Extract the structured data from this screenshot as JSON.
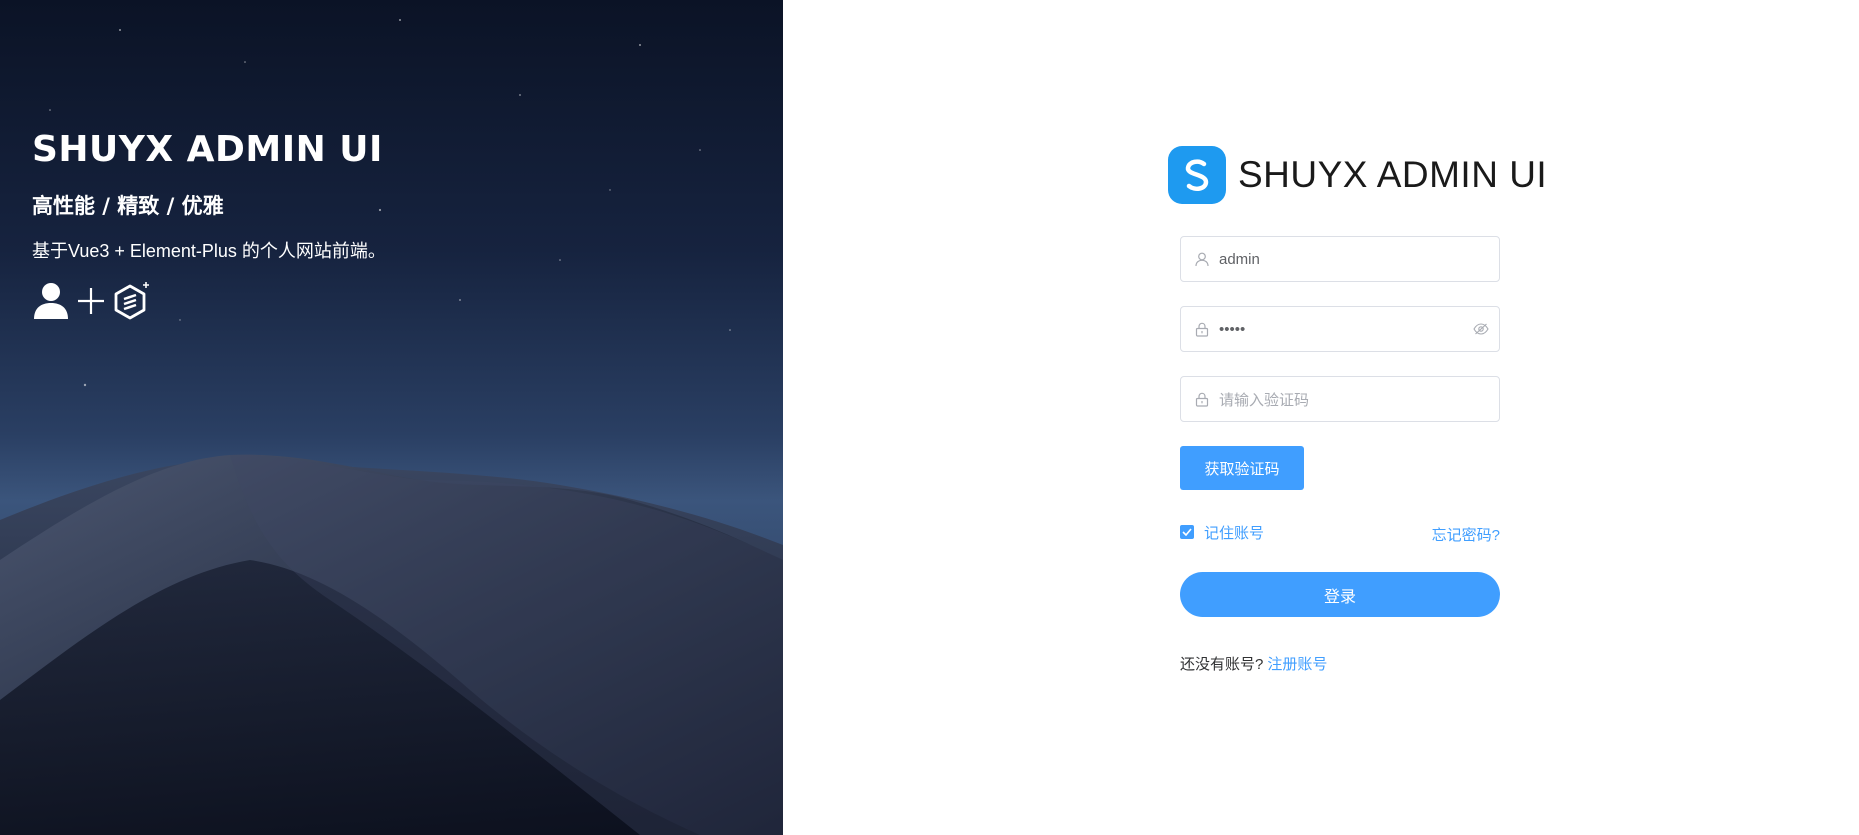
{
  "hero": {
    "title": "SHUYX ADMIN UI",
    "tagline": "高性能 / 精致 / 优雅",
    "description": "基于Vue3 + Element-Plus 的个人网站前端。",
    "icons": [
      "user-icon",
      "plus-icon",
      "element-plus-logo-icon"
    ]
  },
  "brand": {
    "logo_icon": "s-logo-icon",
    "name": "SHUYX ADMIN UI",
    "accent_color": "#1e9af0"
  },
  "form": {
    "username": {
      "icon": "user-icon",
      "value": "admin"
    },
    "password": {
      "icon": "lock-icon",
      "value": "•••••",
      "toggle_icon": "eye-hidden-icon"
    },
    "captcha": {
      "icon": "lock-icon",
      "placeholder": "请输入验证码"
    },
    "get_code_label": "获取验证码",
    "remember_label": "记住账号",
    "remember_checked": true,
    "forgot_label": "忘记密码?",
    "login_label": "登录",
    "no_account_text": "还没有账号?",
    "register_label": "注册账号",
    "primary_color": "#409eff"
  }
}
